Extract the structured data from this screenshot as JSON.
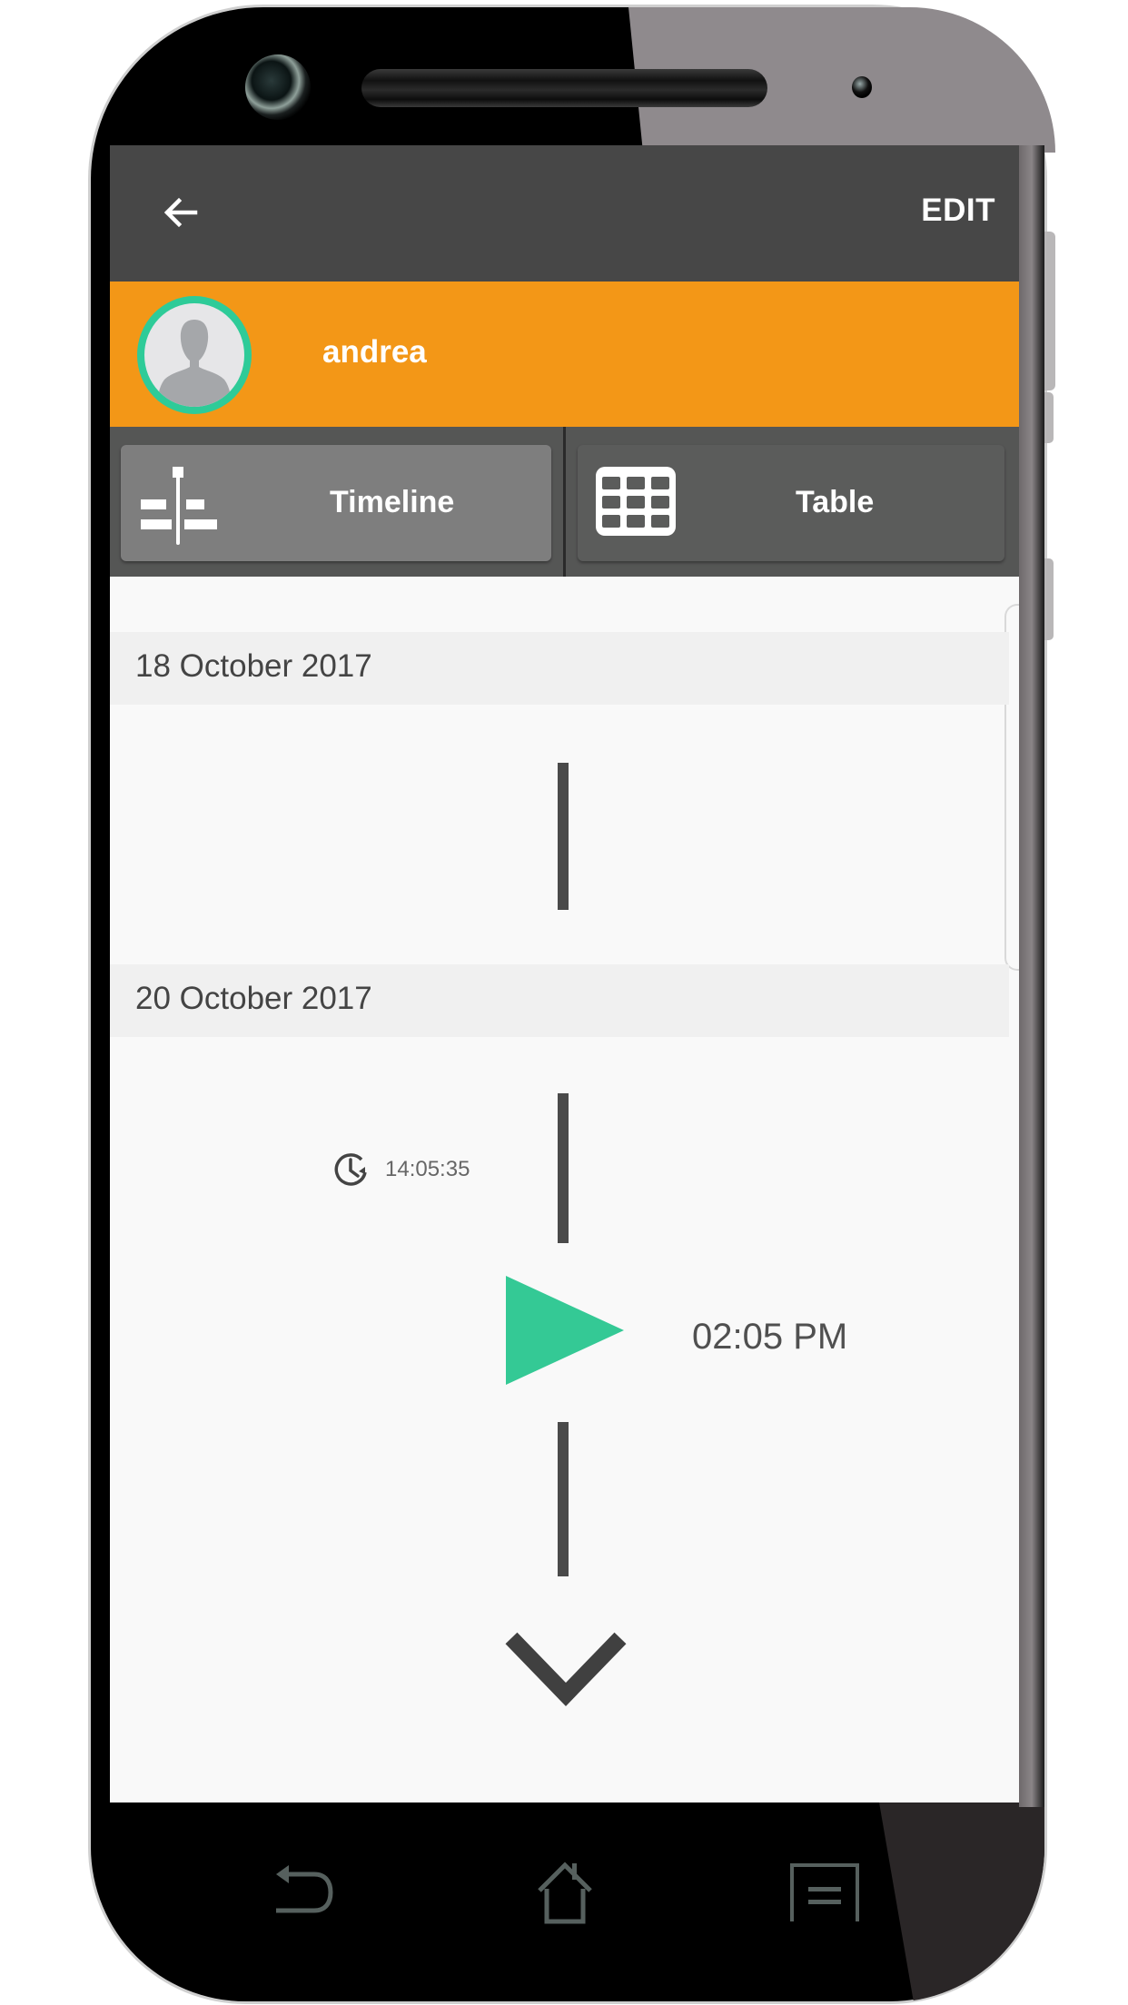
{
  "app_bar": {
    "back_icon": "arrow-left-icon",
    "edit_label": "EDIT"
  },
  "user": {
    "name": "andrea",
    "avatar_icon": "person-silhouette-icon"
  },
  "tabs": [
    {
      "label": "Timeline",
      "icon": "timeline-icon",
      "selected": true
    },
    {
      "label": "Table",
      "icon": "grid-table-icon",
      "selected": false
    }
  ],
  "timeline": {
    "days": [
      {
        "date": "18 October 2017",
        "events": []
      },
      {
        "date": "20 October 2017",
        "events": [
          {
            "duration": "14:05:35",
            "duration_icon": "clock-history-icon",
            "marker_icon": "play-triangle-icon",
            "time": "02:05 PM"
          }
        ]
      }
    ],
    "expand_icon": "chevron-down-icon"
  },
  "nav_bar": {
    "back": "nav-back-icon",
    "home": "nav-home-icon",
    "menu": "nav-menu-icon"
  },
  "colors": {
    "app_bar": "#474747",
    "user_bar": "#f39717",
    "avatar_ring": "#2ecb98",
    "marker": "#34c995",
    "tab_selected": "#7e7e7e",
    "tab_unselected": "#5b5c5b"
  }
}
